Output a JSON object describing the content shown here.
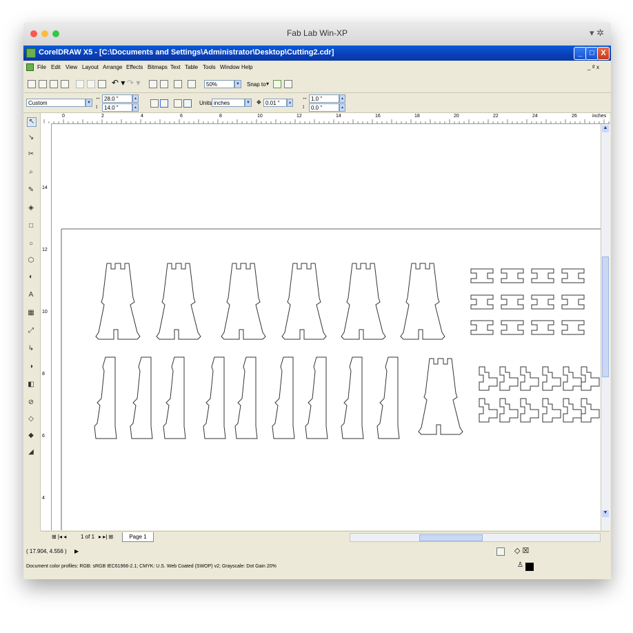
{
  "mac_window": {
    "title": "Fab Lab Win-XP",
    "gear_icon": "gear-icon",
    "dot_colors": [
      "#fc5753",
      "#fdbc40",
      "#33c748"
    ]
  },
  "app": {
    "title": "CorelDRAW X5 - [C:\\Documents and Settings\\Administrator\\Desktop\\Cutting2.cdr]",
    "menu": [
      "File",
      "Edit",
      "View",
      "Layout",
      "Arrange",
      "Effects",
      "Bitmaps",
      "Text",
      "Table",
      "Tools",
      "Window",
      "Help"
    ],
    "doc_controls": "_ ₫ x"
  },
  "toolbar1": {
    "zoom": "50%",
    "snap_to": "Snap to"
  },
  "toolbar2": {
    "page_preset": "Custom",
    "width": "28.0 \"",
    "height": "14.0 \"",
    "units_label": "Units:",
    "units_value": "inches",
    "nudge": "0.01 \"",
    "dup_x": "1.0 \"",
    "dup_y": "0.0 \""
  },
  "ruler": {
    "h_labels": [
      "0",
      "2",
      "4",
      "6",
      "8",
      "10",
      "12",
      "14",
      "16",
      "18",
      "20",
      "22",
      "24",
      "26"
    ],
    "unit": "inches",
    "v_labels": [
      "14",
      "12",
      "10",
      "8",
      "6",
      "4"
    ]
  },
  "pages": {
    "counter": "1 of 1",
    "tab": "Page 1"
  },
  "status": {
    "coords": "( 17.904, 4.556 )",
    "profiles": "Document color profiles: RGB: sRGB IEC61966-2.1; CMYK: U.S. Web Coated (SWOP) v2; Grayscale: Dot Gain 20%"
  },
  "colors": {
    "xp_blue": "#0a4fc8",
    "chrome": "#ece9d8"
  }
}
